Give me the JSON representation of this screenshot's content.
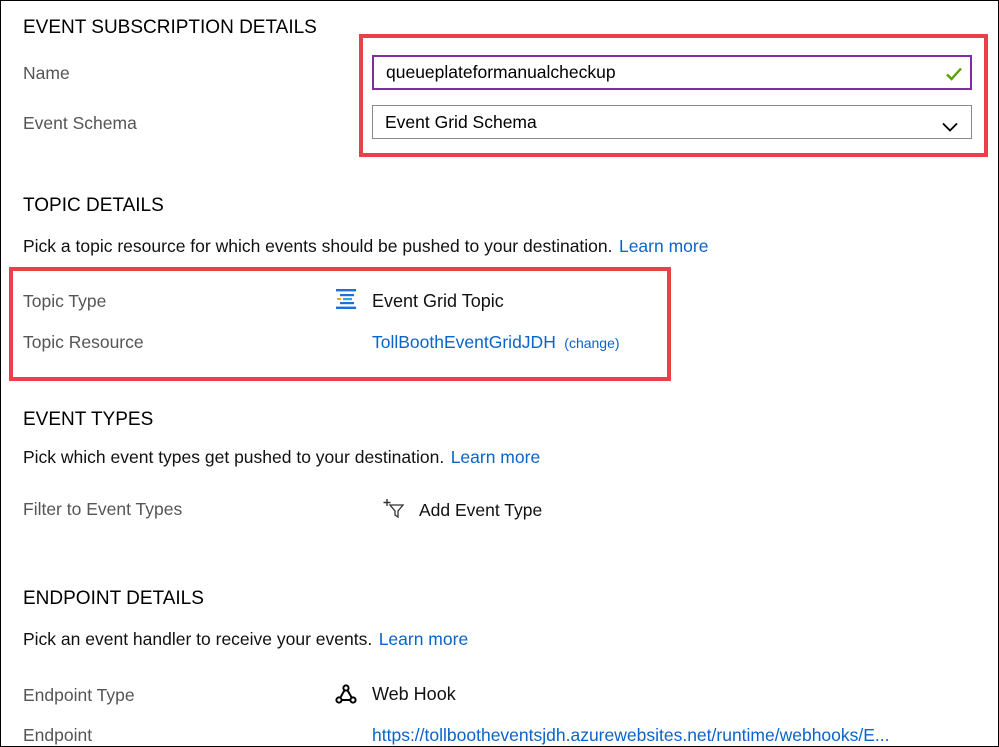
{
  "subscription": {
    "heading": "EVENT SUBSCRIPTION DETAILS",
    "name_label": "Name",
    "name_value": "queueplateformanualcheckup",
    "schema_label": "Event Schema",
    "schema_value": "Event Grid Schema"
  },
  "topic": {
    "heading": "TOPIC DETAILS",
    "description": "Pick a topic resource for which events should be pushed to your destination.",
    "learn_more": "Learn more",
    "type_label": "Topic Type",
    "type_value": "Event Grid Topic",
    "resource_label": "Topic Resource",
    "resource_value": "TollBoothEventGridJDH",
    "change_link": "(change)"
  },
  "event_types": {
    "heading": "EVENT TYPES",
    "description": "Pick which event types get pushed to your destination.",
    "learn_more": "Learn more",
    "filter_label": "Filter to Event Types",
    "add_button": "Add Event Type"
  },
  "endpoint": {
    "heading": "ENDPOINT DETAILS",
    "description": "Pick an event handler to receive your events.",
    "learn_more": "Learn more",
    "type_label": "Endpoint Type",
    "type_value": "Web Hook",
    "endpoint_label": "Endpoint",
    "endpoint_value": "https://tollbootheventsjdh.azurewebsites.net/runtime/webhooks/E..."
  },
  "colors": {
    "highlight_box": "#e8414b",
    "link": "#0a64c9",
    "valid_check": "#57a300",
    "focused_input_border": "#7e2ea1"
  },
  "icons": {
    "valid": "checkmark-icon",
    "dropdown": "chevron-down-icon",
    "topic_type": "event-grid-topic-icon",
    "add_event_type": "add-filter-icon",
    "endpoint_type": "webhook-icon"
  }
}
